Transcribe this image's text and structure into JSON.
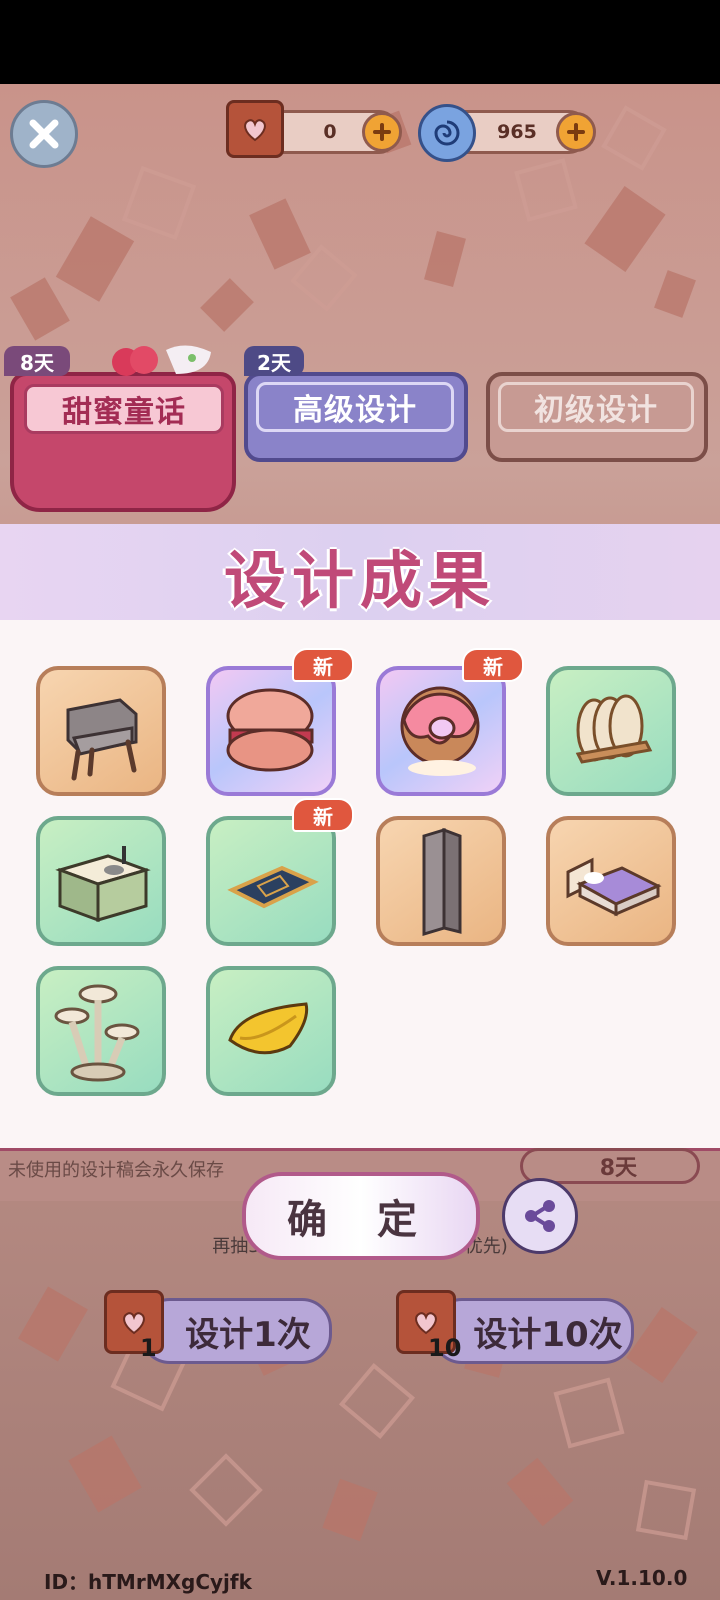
{
  "currency": {
    "tickets": "0",
    "gems": "965",
    "ticket_icon": "heart-ticket-icon",
    "gem_icon": "swirl-gem-icon"
  },
  "tabs": [
    {
      "label": "甜蜜童话",
      "badge": "8天"
    },
    {
      "label": "高级设计",
      "badge": "2天"
    },
    {
      "label": "初级设计",
      "badge": ""
    }
  ],
  "modal": {
    "title": "设计成果",
    "new_tag": "新",
    "items": [
      {
        "name": "armchair",
        "icon": "gray-armchair-icon",
        "frame": "orange",
        "is_new": false
      },
      {
        "name": "macaron",
        "icon": "macaron-icon",
        "frame": "purple",
        "is_new": true
      },
      {
        "name": "donut",
        "icon": "pink-donut-icon",
        "frame": "purple",
        "is_new": true
      },
      {
        "name": "plate-rack",
        "icon": "plate-rack-icon",
        "frame": "green",
        "is_new": false
      },
      {
        "name": "kitchen-counter",
        "icon": "sink-counter-icon",
        "frame": "green",
        "is_new": false
      },
      {
        "name": "rug",
        "icon": "blue-rug-icon",
        "frame": "green",
        "is_new": true
      },
      {
        "name": "pillar",
        "icon": "gray-pillar-icon",
        "frame": "orange",
        "is_new": false
      },
      {
        "name": "bed",
        "icon": "bed-icon",
        "frame": "orange",
        "is_new": false
      },
      {
        "name": "mushroom-lamp",
        "icon": "mushroom-lamp-icon",
        "frame": "green",
        "is_new": false
      },
      {
        "name": "banana-boat",
        "icon": "banana-boat-icon",
        "frame": "green",
        "is_new": false
      }
    ]
  },
  "footer": {
    "save_note": "未使用的设计稿会永久保存",
    "timer": "8天",
    "confirm_label": "确 定",
    "guarantee_note": "再抽3次必得卡牌家具(未拥有的优先)",
    "draw_once_label": "设计1次",
    "draw_once_cost": "1",
    "draw_ten_label": "设计10次",
    "draw_ten_cost": "10",
    "player_id": "ID：hTMrMXgCyjfk",
    "version": "V.1.10.0"
  }
}
